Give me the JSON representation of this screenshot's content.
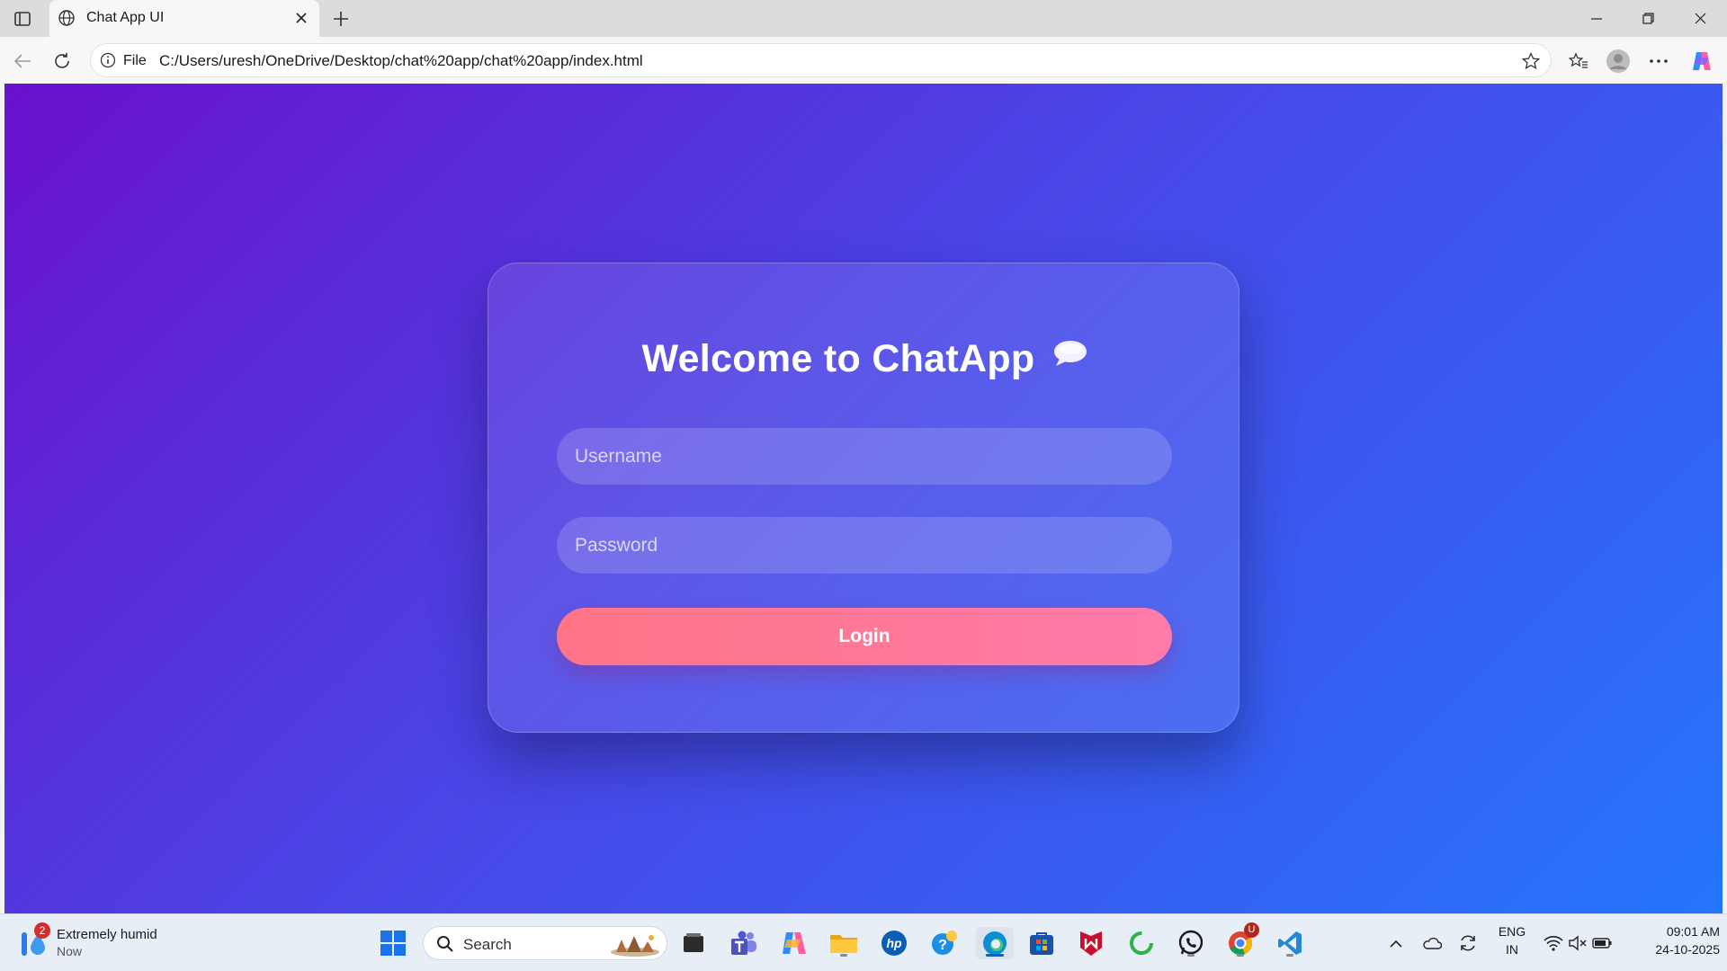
{
  "browser": {
    "tab_title": "Chat App UI",
    "address_scheme": "File",
    "address_url": "C:/Users/uresh/OneDrive/Desktop/chat%20app/chat%20app/index.html",
    "icons": [
      "sidebar-toggle-icon",
      "globe-icon",
      "close-icon",
      "plus-icon",
      "minimize-icon",
      "restore-icon",
      "window-close-icon",
      "back-icon",
      "refresh-icon",
      "info-icon",
      "star-icon",
      "favorites-icon",
      "profile-icon",
      "more-icon",
      "copilot-icon"
    ]
  },
  "page": {
    "title": "Welcome to ChatApp",
    "title_emoji": "speech-bubble",
    "username_placeholder": "Username",
    "password_placeholder": "Password",
    "login_label": "Login",
    "colors": {
      "gradient_start": "#6a11cb",
      "gradient_end": "#2575fc",
      "button_start": "#ff7485",
      "button_end": "#ff7bab"
    }
  },
  "taskbar": {
    "weather_badge": "2",
    "weather_text": "Extremely humid",
    "weather_subtext": "Now",
    "search_label": "Search",
    "lang_top": "ENG",
    "lang_bottom": "IN",
    "time": "09:01 AM",
    "date": "24-10-2025",
    "chrome_badge": "U"
  }
}
